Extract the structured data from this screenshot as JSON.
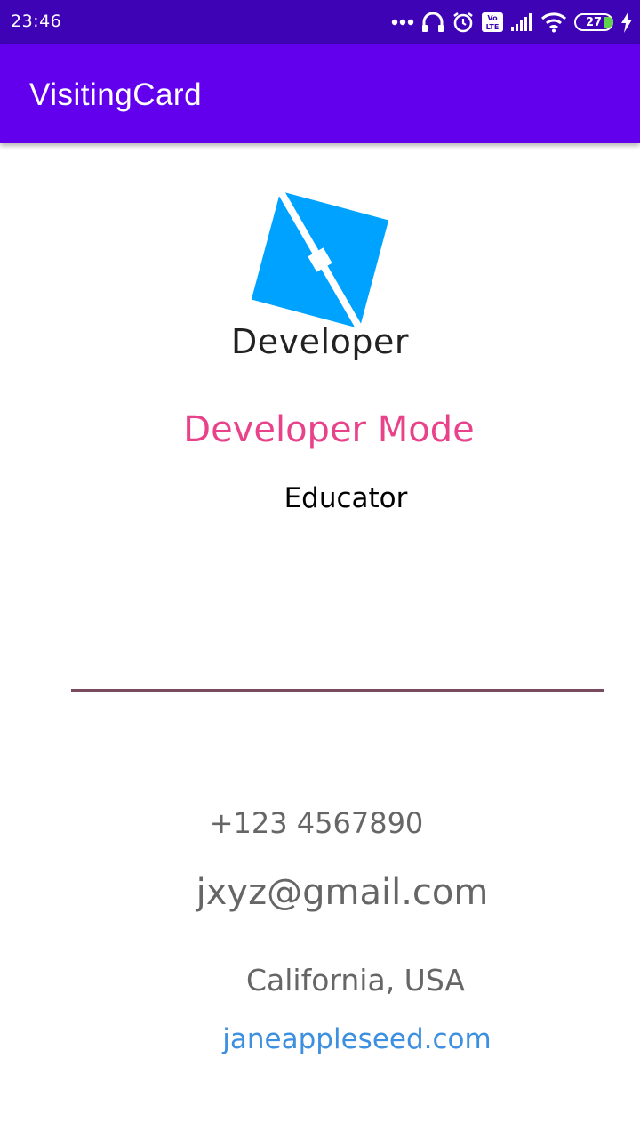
{
  "status_bar": {
    "time": "23:46",
    "battery_level": "27",
    "icons": [
      "more-dots-icon",
      "headphones-icon",
      "alarm-icon",
      "volte-icon",
      "signal-icon",
      "wifi-icon",
      "battery-icon",
      "charging-icon"
    ],
    "volte_label": "Vo LTE"
  },
  "app_bar": {
    "title": "VisitingCard"
  },
  "card": {
    "logo_caption": "Developer",
    "name": "Developer Mode",
    "role": "Educator",
    "phone": "+123 4567890",
    "email": "jxyz@gmail.com",
    "location": "California, USA",
    "website": "janeappleseed.com"
  },
  "colors": {
    "status_bar": "#3e03b5",
    "app_bar": "#6200ee",
    "logo_blue": "#00a2ff",
    "name_pink": "#e8438a",
    "divider": "#7a4a5e",
    "contact_gray": "#666666",
    "link_blue": "#3d8fe0",
    "battery_green": "#5fd44b"
  }
}
